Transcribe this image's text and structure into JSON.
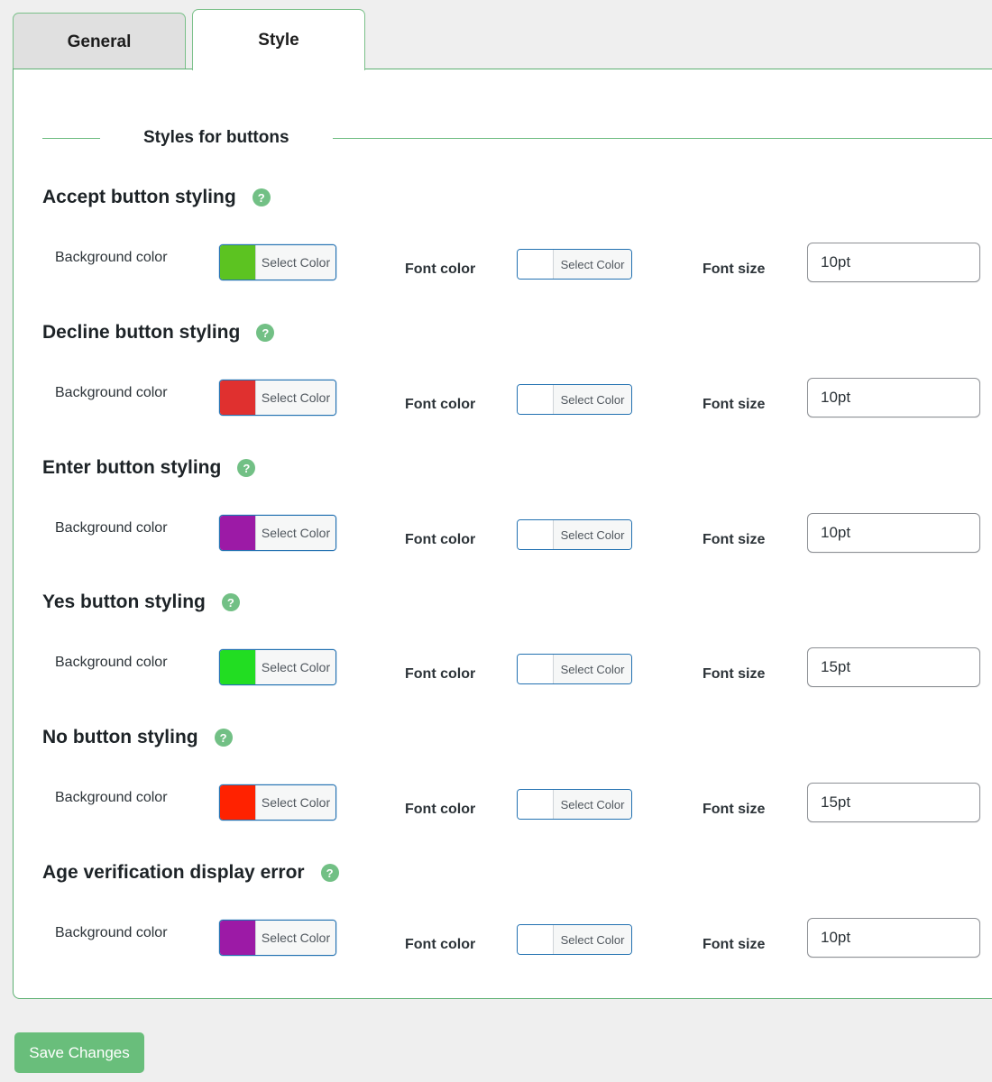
{
  "tabs": [
    {
      "label": "General",
      "active": false
    },
    {
      "label": "Style",
      "active": true
    }
  ],
  "section": {
    "title": "Styles for buttons"
  },
  "labels": {
    "background_color": "Background color",
    "font_color": "Font color",
    "font_size": "Font size",
    "select_color": "Select Color",
    "help_glyph": "?"
  },
  "groups": [
    {
      "title": "Accept button styling",
      "background_color": "#5cc321",
      "font_color": "#ffffff",
      "font_size": "10pt"
    },
    {
      "title": "Decline button styling",
      "background_color": "#e0302f",
      "font_color": "#ffffff",
      "font_size": "10pt"
    },
    {
      "title": "Enter button styling",
      "background_color": "#9c1aa6",
      "font_color": "#ffffff",
      "font_size": "10pt"
    },
    {
      "title": "Yes button styling",
      "background_color": "#22dd22",
      "font_color": "#ffffff",
      "font_size": "15pt"
    },
    {
      "title": "No button styling",
      "background_color": "#ff2200",
      "font_color": "#ffffff",
      "font_size": "15pt"
    },
    {
      "title": "Age verification display error",
      "background_color": "#9c1aa6",
      "font_color": "#ffffff",
      "font_size": "10pt"
    }
  ],
  "footer": {
    "save_label": "Save Changes"
  },
  "colors": {
    "accent_green": "#69be7b",
    "panel_border": "#5cb071",
    "page_background": "#efefef",
    "picker_border": "#2271b1"
  }
}
